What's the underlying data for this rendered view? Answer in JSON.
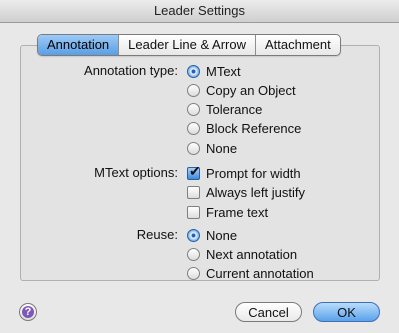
{
  "window": {
    "title": "Leader Settings"
  },
  "tabs": [
    {
      "label": "Annotation",
      "active": true
    },
    {
      "label": "Leader Line & Arrow",
      "active": false
    },
    {
      "label": "Attachment",
      "active": false
    }
  ],
  "annotation": {
    "type_label": "Annotation type:",
    "types": [
      {
        "label": "MText",
        "selected": true
      },
      {
        "label": "Copy an Object",
        "selected": false
      },
      {
        "label": "Tolerance",
        "selected": false
      },
      {
        "label": "Block Reference",
        "selected": false
      },
      {
        "label": "None",
        "selected": false
      }
    ],
    "mtext_label": "MText options:",
    "mtext_options": [
      {
        "label": "Prompt for width",
        "checked": true
      },
      {
        "label": "Always left justify",
        "checked": false
      },
      {
        "label": "Frame text",
        "checked": false
      }
    ],
    "reuse_label": "Reuse:",
    "reuse_options": [
      {
        "label": "None",
        "selected": true
      },
      {
        "label": "Next annotation",
        "selected": false
      },
      {
        "label": "Current annotation",
        "selected": false
      }
    ]
  },
  "buttons": {
    "help_glyph": "?",
    "cancel": "Cancel",
    "ok": "OK"
  }
}
